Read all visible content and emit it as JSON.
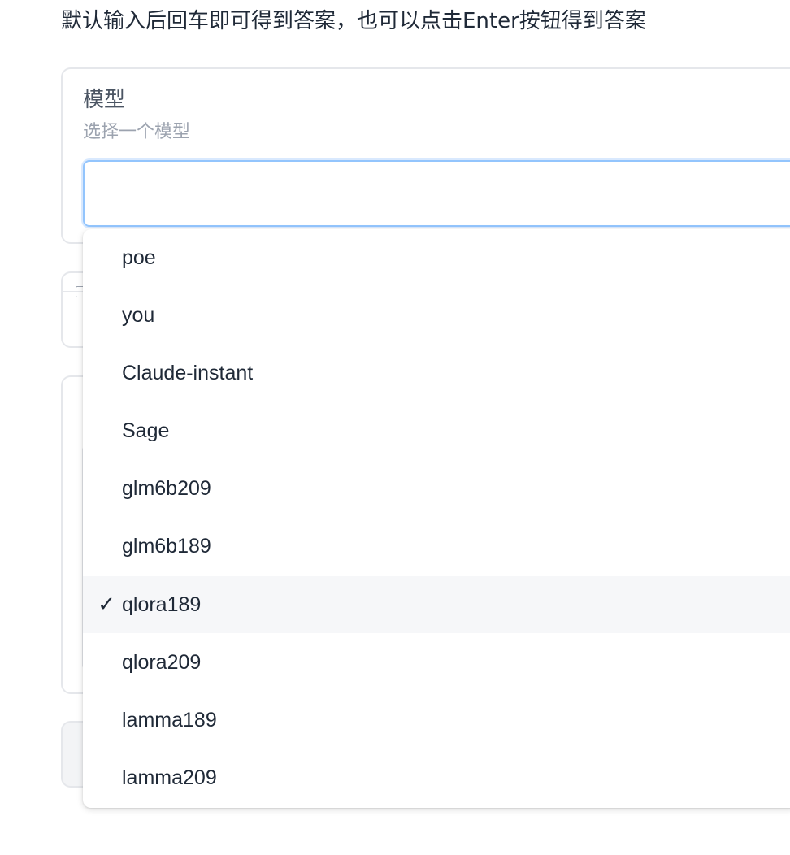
{
  "instructions": "默认输入后回车即可得到答案，也可以点击Enter按钮得到答案",
  "model_select": {
    "label": "模型",
    "info": "选择一个模型",
    "value": "",
    "placeholder": "",
    "selected": "qlora189",
    "options": [
      "poe",
      "you",
      "Claude-instant",
      "Sage",
      "glm6b209",
      "glm6b189",
      "qlora189",
      "qlora209",
      "lamma189",
      "lamma209"
    ],
    "check_icon": "✓"
  },
  "colors": {
    "focus_border": "#93c5fd",
    "selected_bg": "#f6f7f9",
    "label_text": "#4b5563",
    "info_text": "#9ca3af"
  }
}
